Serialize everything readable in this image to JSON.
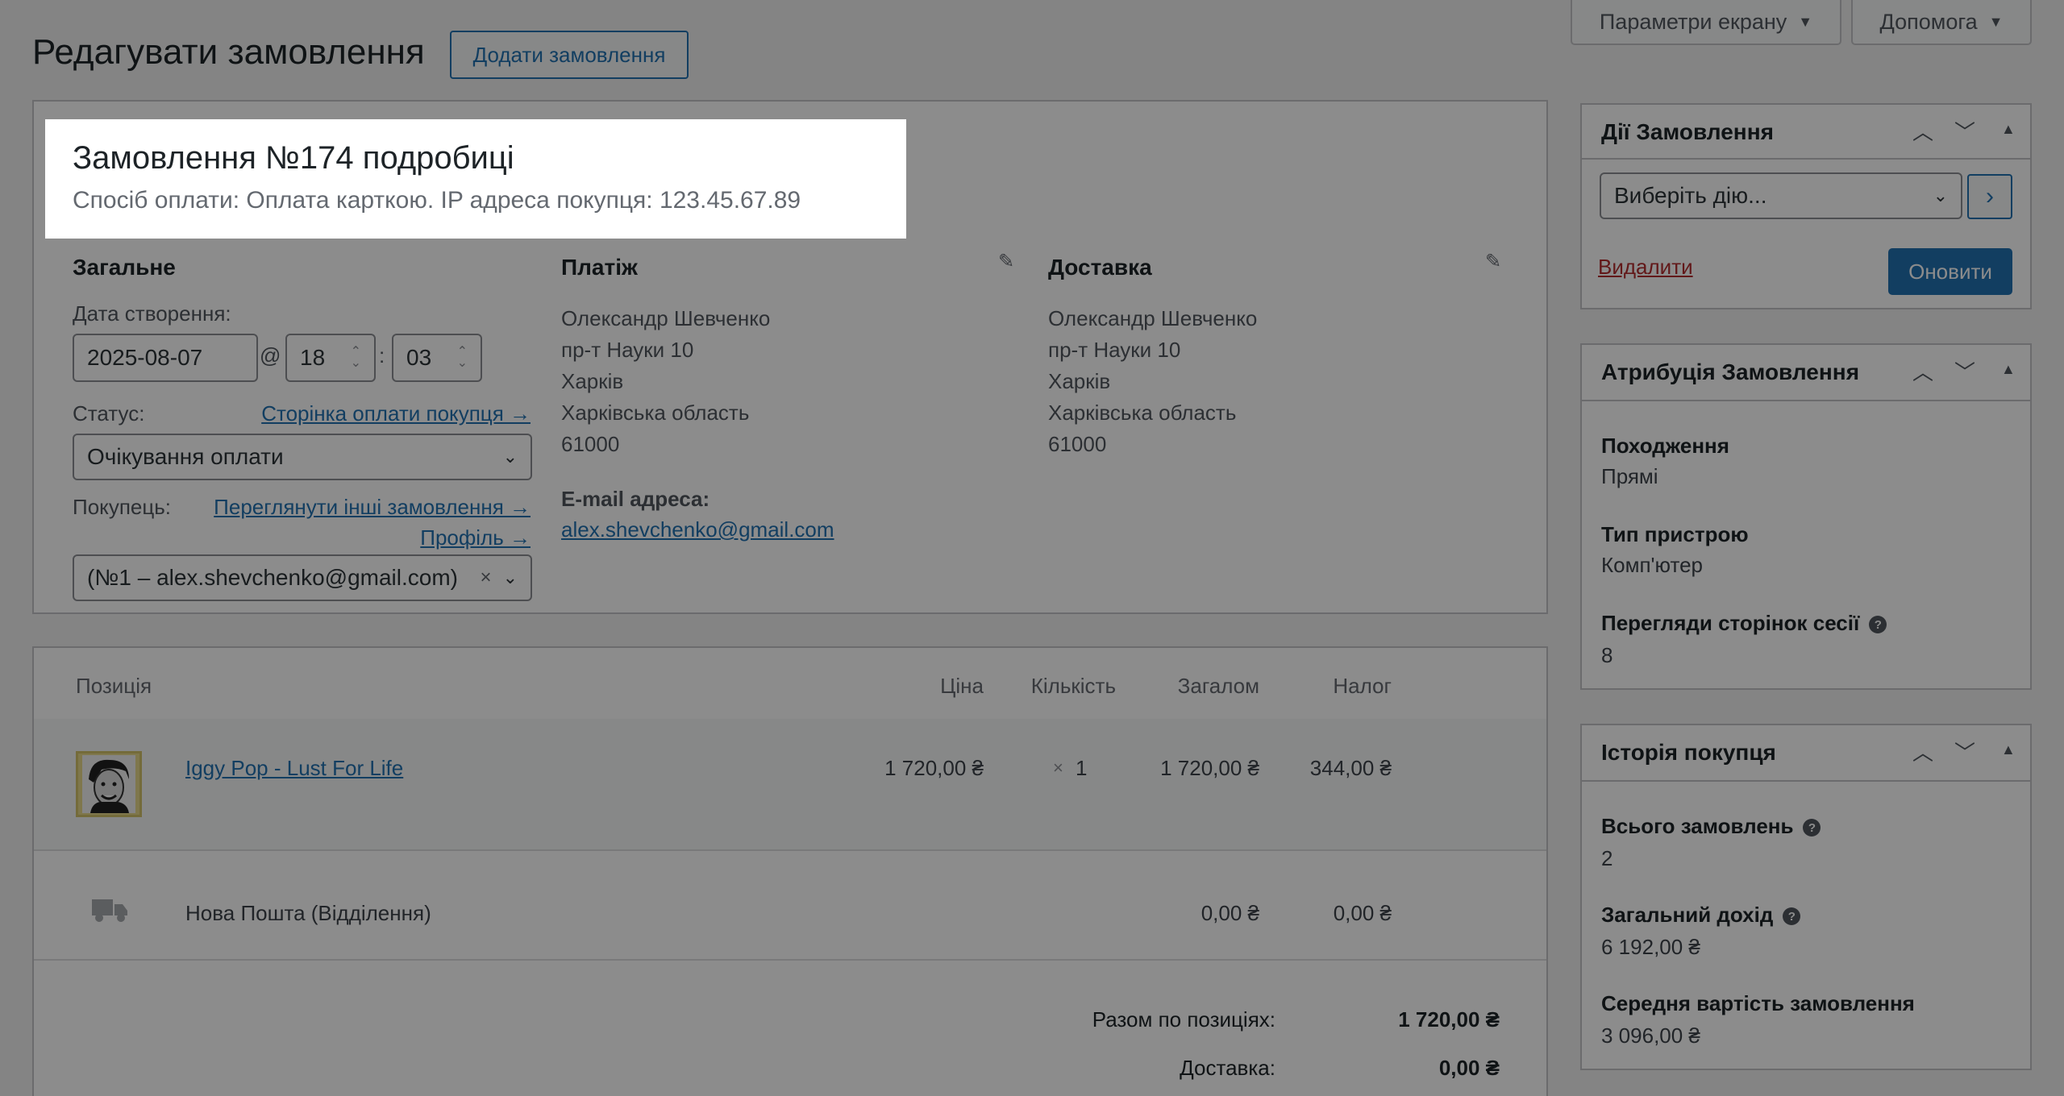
{
  "header": {
    "page_title": "Редагувати замовлення",
    "add_order_button": "Додати замовлення",
    "screen_options": "Параметри екрану",
    "help": "Допомога"
  },
  "order": {
    "title": "Замовлення №174 подробиці",
    "subtitle": "Спосіб оплати: Оплата карткою. IP адреса покупця: 123.45.67.89",
    "general": {
      "heading": "Загальне",
      "date_label": "Дата створення:",
      "date": "2025-08-07",
      "at": "@",
      "hour": "18",
      "colon": ":",
      "minute": "03",
      "status_label": "Статус:",
      "payment_page_link": "Сторінка оплати покупця →",
      "status": "Очікування оплати",
      "customer_label": "Покупець:",
      "other_orders_link": "Переглянути інші замовлення →",
      "profile_link": "Профіль →",
      "customer": "(№1 – alex.shevchenko@gmail.com)",
      "clear": "×"
    },
    "billing": {
      "heading": "Платіж",
      "name": "Олександр Шевченко",
      "street": "пр-т Науки 10",
      "city": "Харків",
      "region": "Харківська область",
      "zip": "61000",
      "email_label": "E-mail адреса:",
      "email": "alex.shevchenko@gmail.com"
    },
    "shipping": {
      "heading": "Доставка",
      "name": "Олександр Шевченко",
      "street": "пр-т Науки 10",
      "city": "Харків",
      "region": "Харківська область",
      "zip": "61000"
    }
  },
  "items": {
    "columns": {
      "item": "Позиція",
      "price": "Ціна",
      "qty": "Кількість",
      "total": "Загалом",
      "tax": "Налог"
    },
    "rows": [
      {
        "name": "Iggy Pop - Lust For Life",
        "price": "1 720,00 ₴",
        "qty_x": "×",
        "qty": "1",
        "total": "1 720,00 ₴",
        "tax": "344,00 ₴"
      }
    ],
    "shipping_row": {
      "name": "Нова Пошта (Відділення)",
      "total": "0,00 ₴",
      "tax": "0,00 ₴"
    },
    "totals": [
      {
        "label": "Разом по позиціях:",
        "value": "1 720,00 ₴"
      },
      {
        "label": "Доставка:",
        "value": "0,00 ₴"
      }
    ]
  },
  "sidebar": {
    "actions": {
      "heading": "Дії Замовлення",
      "select": "Виберіть дію...",
      "go": "›",
      "delete": "Видалити",
      "update": "Оновити"
    },
    "attribution": {
      "heading": "Атрибуція Замовлення",
      "origin_label": "Походження",
      "origin": "Прямі",
      "device_label": "Тип пристрою",
      "device": "Комп'ютер",
      "pageviews_label": "Перегляди сторінок сесії",
      "pageviews": "8",
      "help": "?"
    },
    "history": {
      "heading": "Історія покупця",
      "orders_label": "Всього замовлень",
      "orders": "2",
      "revenue_label": "Загальний дохід",
      "revenue": "6 192,00 ₴",
      "avg_label": "Середня вартість замовлення",
      "avg": "3 096,00 ₴",
      "help": "?"
    }
  },
  "colors": {
    "accent": "#2271b1",
    "primary_button": "#2271b1",
    "delete": "#b32d2e"
  }
}
